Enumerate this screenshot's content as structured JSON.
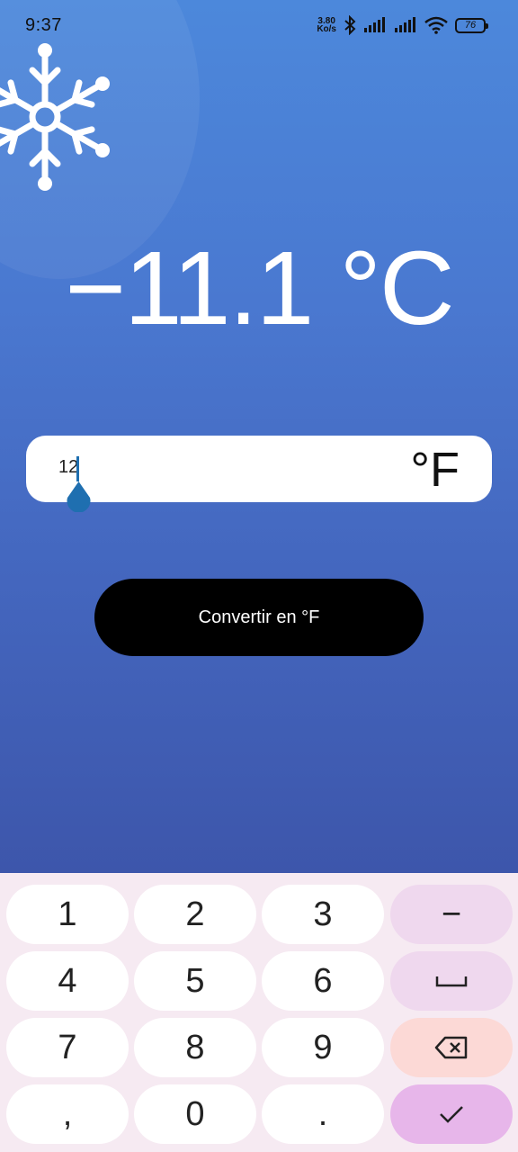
{
  "status_bar": {
    "time": "9:37",
    "net_speed_value": "3.80",
    "net_speed_unit": "Ko/s",
    "battery": "76"
  },
  "converter": {
    "result": "−11.1 °C",
    "input_value": "12",
    "input_unit": "°F",
    "convert_label": "Convertir en °F"
  },
  "keypad": {
    "keys": [
      "1",
      "2",
      "3",
      "−",
      "4",
      "5",
      "6",
      "␣",
      "7",
      "8",
      "9",
      "⌫",
      ",",
      "0",
      ".",
      "✓"
    ]
  },
  "colors": {
    "background_top": "#4c88db",
    "background_bottom": "#3d56ab",
    "button": "#000000",
    "caret": "#1f6fb0",
    "keypad_bg": "#f6eaf2",
    "key_delete": "#fcd9d6",
    "key_confirm": "#e7b6ea"
  }
}
